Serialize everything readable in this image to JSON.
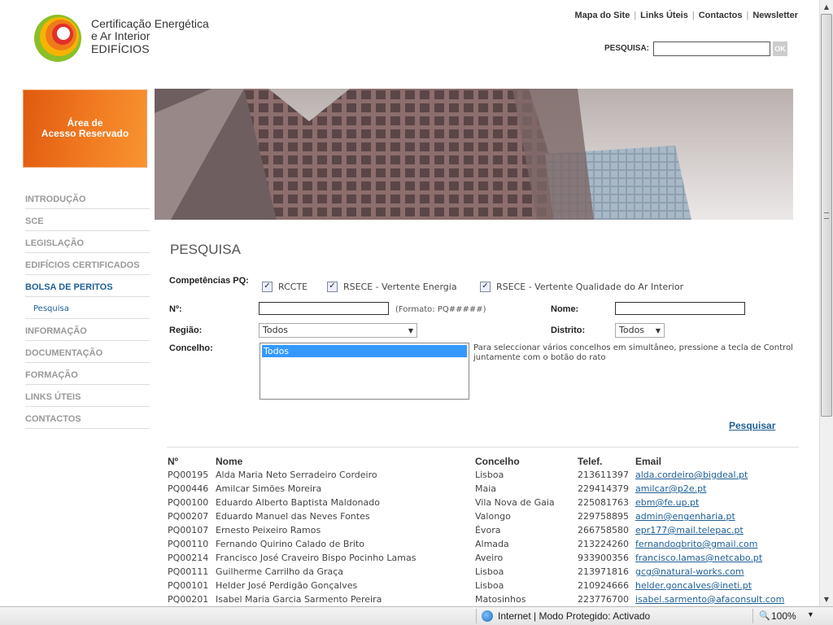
{
  "header": {
    "logo_line1": "Certificação Energética",
    "logo_line2": "e Ar Interior",
    "logo_line3": "EDIFÍCIOS",
    "links": [
      "Mapa do Site",
      "Links Úteis",
      "Contactos",
      "Newsletter"
    ],
    "search_label": "PESQUISA:",
    "search_value": "",
    "search_button": "OK"
  },
  "reserved_area": {
    "line1": "Área de",
    "line2": "Acesso Reservado"
  },
  "menu": {
    "items": [
      "INTRODUÇÃO",
      "SCE",
      "LEGISLAÇÃO",
      "EDIFÍCIOS CERTIFICADOS",
      "BOLSA DE PERITOS",
      "INFORMAÇÃO",
      "DOCUMENTAÇÃO",
      "FORMAÇÃO",
      "LINKS ÚTEIS",
      "CONTACTOS"
    ],
    "sub_item": "Pesquisa"
  },
  "form": {
    "title": "PESQUISA",
    "competencias_label": "Competências PQ:",
    "competencias": [
      {
        "label": "RCCTE",
        "checked": true
      },
      {
        "label": "RSECE - Vertente Energia",
        "checked": true
      },
      {
        "label": "RSECE - Vertente Qualidade do Ar Interior",
        "checked": true
      }
    ],
    "numero_label": "Nº:",
    "numero_value": "",
    "numero_hint": "(Formato: PQ#####)",
    "nome_label": "Nome:",
    "nome_value": "",
    "regiao_label": "Região:",
    "regiao_value": "Todos",
    "distrito_label": "Distrito:",
    "distrito_value": "Todos",
    "concelho_label": "Concelho:",
    "concelho_selected": "Todos",
    "concelho_note": "Para seleccionar vários concelhos em simultâneo, pressione a tecla de Control juntamente com o botão do rato",
    "submit_label": "Pesquisar"
  },
  "results": {
    "columns": [
      "Nº",
      "Nome",
      "Concelho",
      "Telef.",
      "Email"
    ],
    "rows": [
      [
        "PQ00195",
        "Alda Maria Neto Serradeiro Cordeiro",
        "Lisboa",
        "213611397",
        "alda.cordeiro@bigdeal.pt"
      ],
      [
        "PQ00446",
        "Amilcar Simões Moreira",
        "Maia",
        "229414379",
        "amilcar@p2e.pt"
      ],
      [
        "PQ00100",
        "Eduardo Alberto Baptista Maldonado",
        "Vila Nova de Gaia",
        "225081763",
        "ebm@fe.up.pt"
      ],
      [
        "PQ00207",
        "Eduardo Manuel das Neves Fontes",
        "Valongo",
        "229758895",
        "admin@engenharia.pt"
      ],
      [
        "PQ00107",
        "Ernesto Peixeiro Ramos",
        "Évora",
        "266758580",
        "epr177@mail.telepac.pt"
      ],
      [
        "PQ00110",
        "Fernando Quirino Calado de Brito",
        "Almada",
        "213224260",
        "fernandoqbrito@gmail.com"
      ],
      [
        "PQ00214",
        "Francisco José Craveiro Bispo Pocinho Lamas",
        "Aveiro",
        "933900356",
        "francisco.lamas@netcabo.pt"
      ],
      [
        "PQ00111",
        "Guilherme Carrilho da Graça",
        "Lisboa",
        "213971816",
        "gcg@natural-works.com"
      ],
      [
        "PQ00101",
        "Helder José Perdigão Gonçalves",
        "Lisboa",
        "210924666",
        "helder.goncalves@ineti.pt"
      ],
      [
        "PQ00201",
        "Isabel Maria Garcia Sarmento Pereira",
        "Matosinhos",
        "223776700",
        "isabel.sarmento@afaconsult.com"
      ]
    ]
  },
  "statusbar": {
    "zone": "Internet | Modo Protegido: Activado",
    "zoom": "100%"
  },
  "colors": {
    "accent_orange": "#f07820",
    "link_blue": "#1e5f96",
    "menu_grey": "#999999"
  }
}
